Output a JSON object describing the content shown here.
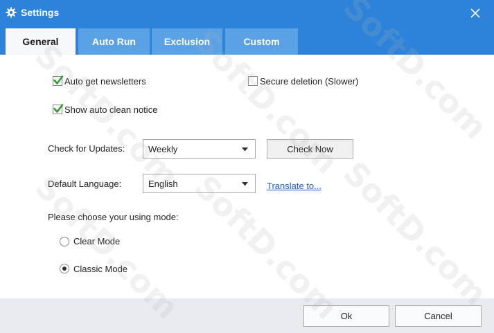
{
  "window": {
    "title": "Settings"
  },
  "tabs": [
    {
      "label": "General",
      "active": true
    },
    {
      "label": "Auto Run",
      "active": false
    },
    {
      "label": "Exclusion",
      "active": false
    },
    {
      "label": "Custom",
      "active": false
    }
  ],
  "general": {
    "auto_newsletters": {
      "label": "Auto get newsletters",
      "checked": true
    },
    "secure_deletion": {
      "label": "Secure deletion (Slower)",
      "checked": false
    },
    "auto_clean_notice": {
      "label": "Show auto clean notice",
      "checked": true
    },
    "check_updates": {
      "label": "Check for Updates:",
      "value": "Weekly",
      "button": "Check Now"
    },
    "default_language": {
      "label": "Default Language:",
      "value": "English",
      "link": "Translate to..."
    },
    "mode": {
      "label": "Please choose your using mode:",
      "options": [
        {
          "label": "Clear Mode",
          "selected": false
        },
        {
          "label": "Classic Mode",
          "selected": true
        }
      ]
    }
  },
  "footer": {
    "ok_label": "Ok",
    "cancel_label": "Cancel"
  },
  "watermark": "SoftD.com",
  "colors": {
    "title_bar": "#2d83da",
    "tab_inactive": "#5aa1e6",
    "tab_active": "#f7f8fa",
    "link": "#1e5fbf",
    "check": "#2e9b2e",
    "footer": "#e9ebee"
  },
  "icons": {
    "title": "gear-icon",
    "close": "close-icon",
    "dropdown": "chevron-down-icon",
    "check": "checkmark-icon"
  }
}
